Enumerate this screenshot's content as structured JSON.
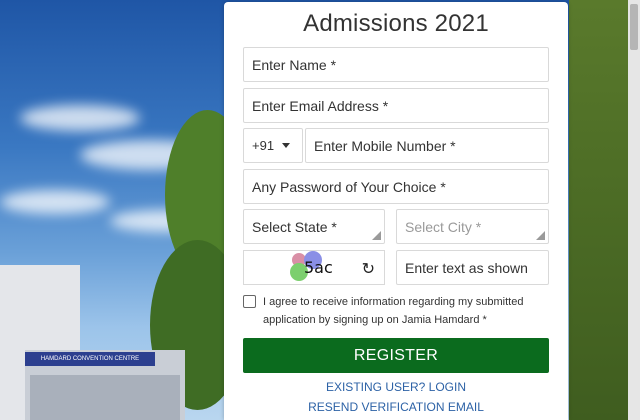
{
  "form": {
    "title": "Admissions 2021",
    "name_placeholder": "Enter Name *",
    "email_placeholder": "Enter Email Address *",
    "country_code": "+91",
    "mobile_placeholder": "Enter Mobile Number *",
    "password_placeholder": "Any Password of Your Choice *",
    "state_placeholder": "Select State *",
    "city_placeholder": "Select City *",
    "captcha_text": "5ac",
    "captcha_input_placeholder": "Enter text as shown",
    "consent_text": "I agree to receive information regarding my submitted application by signing up on Jamia Hamdard *",
    "register_label": "REGISTER",
    "login_link": "EXISTING USER? LOGIN",
    "resend_link": "RESEND VERIFICATION EMAIL"
  },
  "background": {
    "building_sign": "HAMDARD CONVENTION CENTRE"
  },
  "colors": {
    "register_bg": "#0b6b1e",
    "link": "#2d62a6"
  },
  "icons": {
    "refresh": "refresh-icon",
    "dropdown": "chevron-down-icon"
  }
}
